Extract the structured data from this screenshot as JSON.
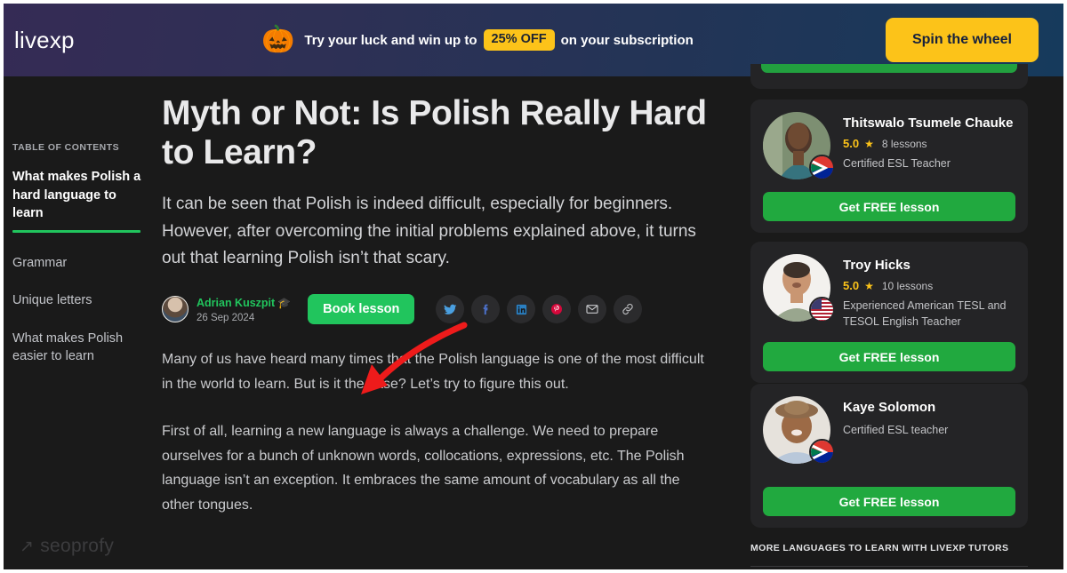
{
  "banner": {
    "logo": "livexp",
    "pumpkin_icon": "jack-o-lantern",
    "text_before": "Try your luck and win up to",
    "discount": "25% OFF",
    "text_after": "on your subscription",
    "cta": "Spin the wheel",
    "accent_yellow": "#fcc319"
  },
  "toc": {
    "title": "TABLE OF CONTENTS",
    "items": [
      {
        "label": "What makes Polish a hard language to learn",
        "active": true
      },
      {
        "label": "Grammar",
        "active": false
      },
      {
        "label": "Unique letters",
        "active": false
      },
      {
        "label": "What makes Polish easier to learn",
        "active": false
      }
    ],
    "active_underline_color": "#21c55d"
  },
  "article": {
    "title": "Myth or Not: Is Polish Really Hard to Learn?",
    "lede": "It can be seen that Polish is indeed difficult, especially for beginners. However, after overcoming the initial problems explained above, it turns out that learning Polish isn’t that scary.",
    "author": {
      "name": "Adrian Kuszpit",
      "cap_icon": "graduation-cap-icon",
      "date": "26 Sep 2024",
      "name_color": "#21c55d"
    },
    "book_lesson_label": "Book lesson",
    "share": [
      {
        "name": "twitter-icon",
        "title": "Twitter"
      },
      {
        "name": "facebook-icon",
        "title": "Facebook"
      },
      {
        "name": "linkedin-icon",
        "title": "LinkedIn"
      },
      {
        "name": "pinterest-icon",
        "title": "Pinterest"
      },
      {
        "name": "email-icon",
        "title": "Email"
      },
      {
        "name": "link-icon",
        "title": "Copy link"
      }
    ],
    "paragraphs": [
      "Many of us have heard many times that the Polish language is one of the most difficult in the world to learn. But is it the case? Let’s try to figure this out.",
      "First of all, learning a new language is always a challenge. We need to prepare ourselves for a bunch of unknown words, collocations, expressions, etc. The Polish language isn’t an exception. It embraces the same amount of vocabulary as all the other tongues."
    ]
  },
  "annotation": {
    "type": "curved-arrow",
    "color": "#ee1b1b",
    "points_to": "Book lesson"
  },
  "rail": {
    "tutors": [
      {
        "name": "Thitswalo Tsumele Chauke",
        "rating": "5.0",
        "lessons": "8 lessons",
        "role": "Certified ESL Teacher",
        "flag": "south-africa-flag-icon",
        "cta": "Get FREE lesson"
      },
      {
        "name": "Troy Hicks",
        "rating": "5.0",
        "lessons": "10 lessons",
        "role": "Experienced American TESL and TESOL English Teacher",
        "flag": "united-states-flag-icon",
        "cta": "Get FREE lesson"
      },
      {
        "name": "Kaye Solomon",
        "rating": "",
        "lessons": "",
        "role": "Certified ESL teacher",
        "flag": "south-africa-flag-icon",
        "cta": "Get FREE lesson"
      }
    ],
    "more_languages_title": "MORE LANGUAGES TO LEARN WITH LIVEXP TUTORS",
    "cta_green": "#21a93f"
  },
  "watermark": {
    "arrow": "↗",
    "text": "seoprofy"
  }
}
